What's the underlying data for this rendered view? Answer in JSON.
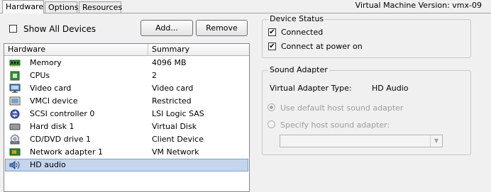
{
  "tabs": [
    {
      "label": "Hardware",
      "active": true
    },
    {
      "label": "Options",
      "active": false
    },
    {
      "label": "Resources",
      "active": false
    }
  ],
  "vm_version": "Virtual Machine Version: vmx-09",
  "show_all_devices": {
    "label": "Show All Devices",
    "checked": false
  },
  "buttons": {
    "add": "Add...",
    "remove": "Remove"
  },
  "hardware_list": {
    "columns": [
      "Hardware",
      "Summary"
    ],
    "rows": [
      {
        "name": "Memory",
        "summary": "4096 MB",
        "icon": "memory-icon"
      },
      {
        "name": "CPUs",
        "summary": "2",
        "icon": "cpu-icon"
      },
      {
        "name": "Video card",
        "summary": "Video card",
        "icon": "monitor-icon"
      },
      {
        "name": "VMCI device",
        "summary": "Restricted",
        "icon": "vmci-icon"
      },
      {
        "name": "SCSI controller 0",
        "summary": "LSI Logic SAS",
        "icon": "scsi-icon"
      },
      {
        "name": "Hard disk 1",
        "summary": "Virtual Disk",
        "icon": "hard-disk-icon"
      },
      {
        "name": "CD/DVD drive 1",
        "summary": "Client Device",
        "icon": "cd-dvd-icon"
      },
      {
        "name": "Network adapter 1",
        "summary": "VM Network",
        "icon": "network-icon"
      },
      {
        "name": "HD audio",
        "summary": "",
        "icon": "speaker-icon",
        "selected": true
      }
    ]
  },
  "device_status": {
    "title": "Device Status",
    "connected": {
      "label": "Connected",
      "checked": true
    },
    "connect_at_power_on": {
      "label": "Connect at power on",
      "checked": true
    }
  },
  "sound_adapter": {
    "title": "Sound Adapter",
    "type_label": "Virtual Adapter Type:",
    "type_value": "HD Audio",
    "use_default_label": "Use default host sound adapter",
    "specify_label": "Specify host sound adapter:",
    "specify_value": ""
  },
  "check_mark": "✔",
  "colors": {
    "selection": "#c5d5ec",
    "selection_border": "#7da2ce",
    "disabled_text": "#9d9d9d"
  }
}
